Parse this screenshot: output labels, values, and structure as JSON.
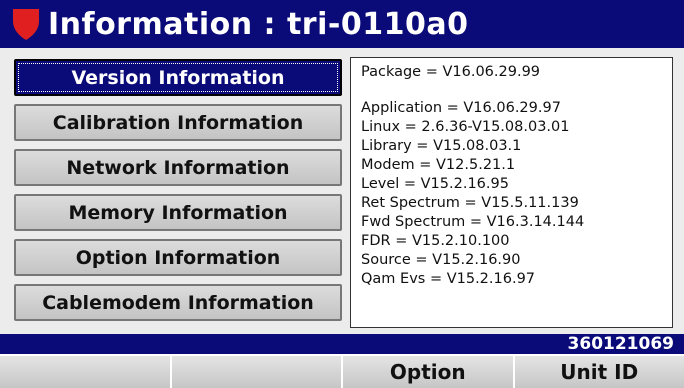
{
  "header": {
    "title": "Information : tri-0110a0",
    "logo_icon": "red-shield-icon",
    "logo_color": "#e02020",
    "bar_color": "#0a0a78"
  },
  "menu": {
    "items": [
      {
        "label": "Version Information",
        "active": true
      },
      {
        "label": "Calibration Information",
        "active": false
      },
      {
        "label": "Network Information",
        "active": false
      },
      {
        "label": "Memory Information",
        "active": false
      },
      {
        "label": "Option Information",
        "active": false
      },
      {
        "label": "Cablemodem Information",
        "active": false
      }
    ]
  },
  "info": {
    "package": "Package = V16.06.29.99",
    "lines": [
      "Application = V16.06.29.97",
      "Linux = 2.6.36-V15.08.03.01",
      "Library = V15.08.03.1",
      "Modem = V12.5.21.1",
      "Level = V15.2.16.95",
      "Ret Spectrum = V15.5.11.139",
      "Fwd Spectrum = V16.3.14.144",
      "FDR = V15.2.10.100",
      "Source = V15.2.16.90",
      "Qam Evs = V15.2.16.97"
    ]
  },
  "status": {
    "serial": "360121069"
  },
  "softkeys": [
    "",
    "",
    "Option",
    "Unit ID"
  ]
}
